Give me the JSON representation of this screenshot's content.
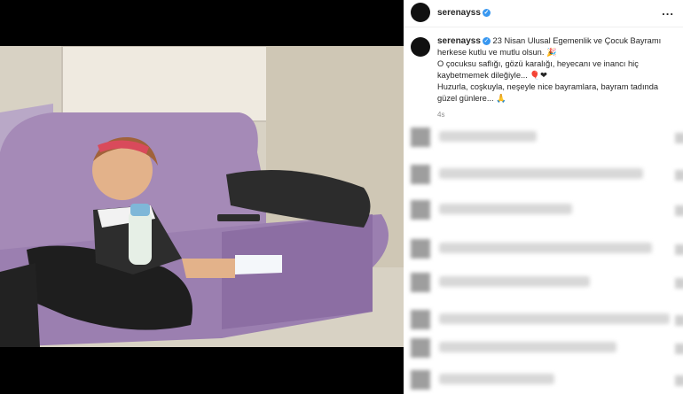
{
  "post": {
    "username": "serenayss",
    "verified_icon": "verified-badge-icon",
    "more_icon": "more-options-icon",
    "more_label": "...",
    "caption": {
      "line1": "23 Nisan Ulusal Egemenlik ve Çocuk Bayramı herkese kutlu ve mutlu olsun.",
      "line2": "O çocuksu saflığı, gözü karalığı, heyecanı ve inancı hiç kaybetmemek dileğiyle...",
      "line3": "Huzurla, coşkuyla, neşeyle nice bayramlara, bayram tadında güzel günlere...",
      "time": "4s"
    }
  },
  "media": {
    "description_icon": "photo-icon"
  },
  "colors": {
    "verified": "#3897f0",
    "text": "#262626",
    "muted": "#8e8e8e",
    "sofa": "#a58ab7"
  }
}
